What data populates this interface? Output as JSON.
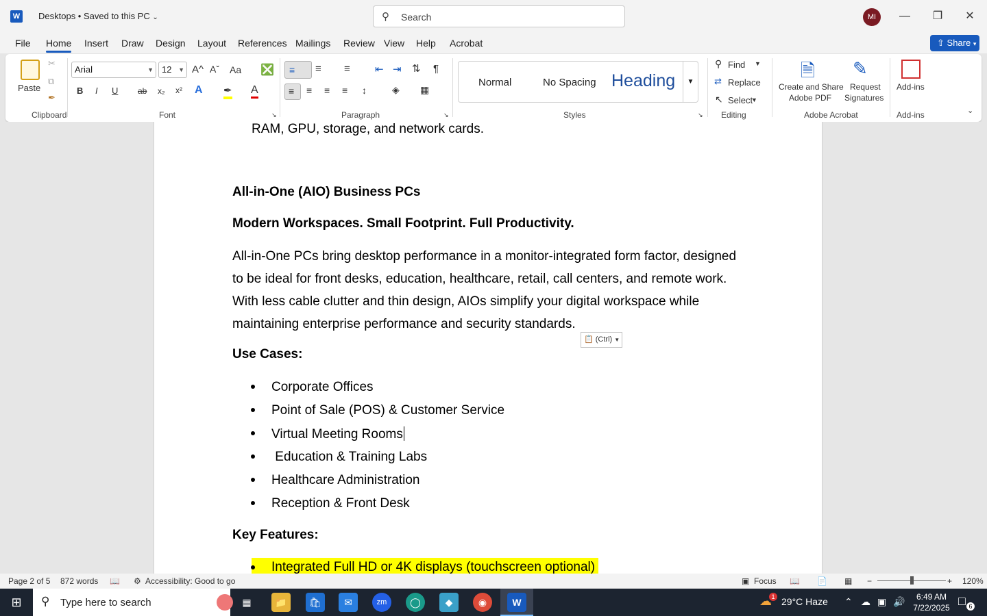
{
  "titlebar": {
    "app_icon": "W",
    "doc_title": "Desktops • Saved to this PC",
    "search_placeholder": "Search",
    "avatar_initials": "MI",
    "minimize": "—",
    "restore": "❐",
    "close": "✕"
  },
  "menu": {
    "tabs": [
      "File",
      "Home",
      "Insert",
      "Draw",
      "Design",
      "Layout",
      "References",
      "Mailings",
      "Review",
      "View",
      "Help",
      "Acrobat"
    ],
    "share_label": "Share"
  },
  "ribbon": {
    "clipboard": {
      "paste_label": "Paste",
      "group_label": "Clipboard"
    },
    "font": {
      "font_name": "Arial",
      "font_size": "12",
      "group_label": "Font",
      "bold": "B",
      "italic": "I",
      "underline": "U",
      "strikethrough": "ab",
      "subscript": "x₂",
      "superscript": "x²",
      "text_effects": "A",
      "font_color": "A",
      "grow": "A^",
      "shrink": "Aˇ",
      "change_case": "Aa"
    },
    "paragraph": {
      "group_label": "Paragraph",
      "pilcrow": "¶"
    },
    "styles": {
      "normal": "Normal",
      "no_spacing": "No Spacing",
      "heading": "Heading",
      "group_label": "Styles"
    },
    "editing": {
      "find": "Find",
      "replace": "Replace",
      "select": "Select",
      "group_label": "Editing"
    },
    "acrobat": {
      "create_share": "Create and Share",
      "adobe_pdf": "Adobe PDF",
      "request": "Request",
      "signatures": "Signatures",
      "group_label": "Adobe Acrobat"
    },
    "addins": {
      "label": "Add-ins",
      "group_label": "Add-ins"
    }
  },
  "document": {
    "top_line": "RAM, GPU, storage, and network cards.",
    "heading1": "All-in-One (AIO) Business PCs",
    "heading2": "Modern Workspaces. Small Footprint. Full Productivity.",
    "para_lines": [
      "All-in-One PCs bring desktop performance in a monitor-integrated form factor, designed",
      "to be ideal for front desks, education, healthcare, retail, call centers, and remote work.",
      "With less cable clutter and thin design, AIOs simplify your digital workspace while",
      "maintaining enterprise performance and security standards."
    ],
    "paste_options": "(Ctrl)",
    "use_cases_heading": "Use Cases:",
    "use_cases": [
      "Corporate Offices",
      "Point of Sale (POS) & Customer Service",
      "Virtual Meeting Rooms",
      " Education & Training Labs",
      "Healthcare Administration",
      "Reception & Front Desk"
    ],
    "key_features_heading": "Key Features:",
    "key_features": [
      "Integrated Full HD or 4K displays (touchscreen optional)"
    ]
  },
  "statusbar": {
    "page": "Page 2 of 5",
    "words": "872 words",
    "accessibility": "Accessibility: Good to go",
    "focus": "Focus",
    "zoom": "120%"
  },
  "taskbar": {
    "search_placeholder": "Type here to search",
    "weather": "29°C  Haze",
    "time": "6:49 AM",
    "date": "7/22/2025",
    "notification_count": "6",
    "weather_badge": "1"
  },
  "colors": {
    "accent": "#185abd",
    "highlight": "#ffff00",
    "avatar": "#7a1a22"
  }
}
